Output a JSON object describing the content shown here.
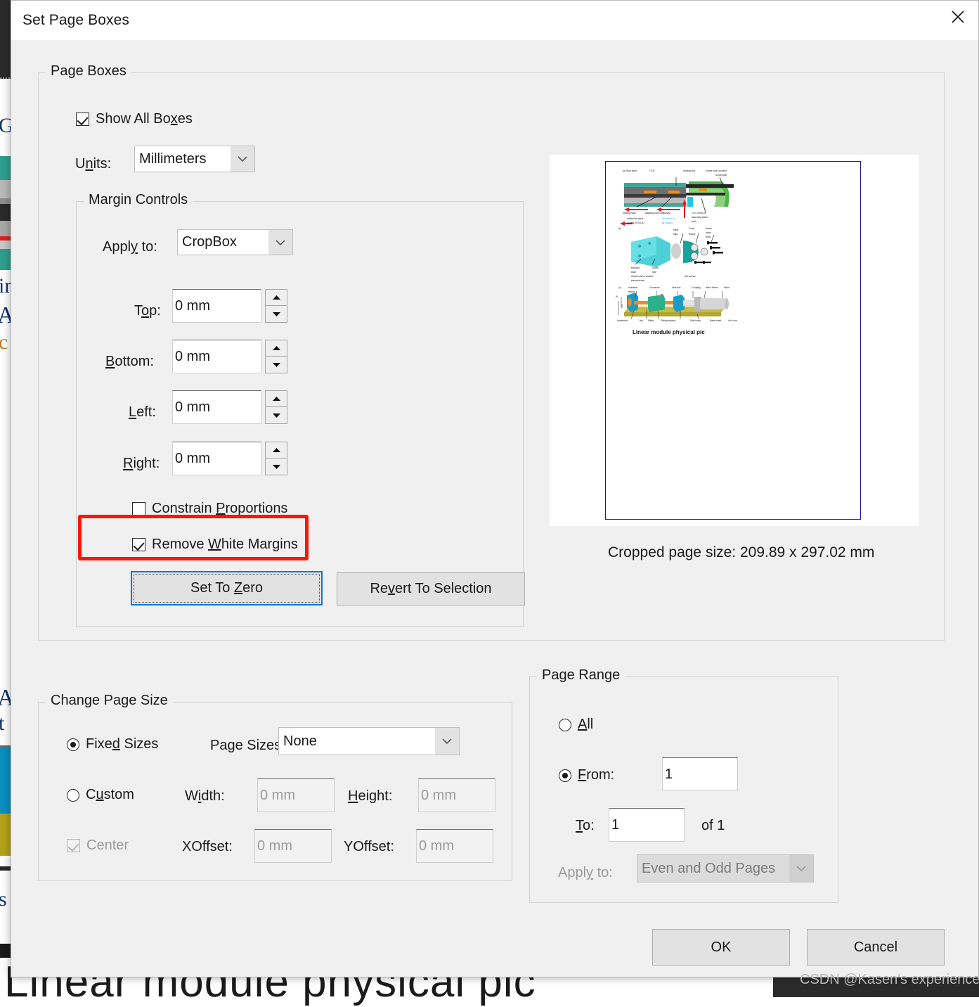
{
  "background": {
    "visible_text_fragments": [
      "Ge",
      "in",
      "A",
      "c",
      "A",
      "t",
      "s"
    ],
    "bottom_text": "Linear module physical pic"
  },
  "dialog": {
    "title": "Set Page Boxes",
    "close_icon": "close-icon"
  },
  "page_boxes": {
    "legend": "Page Boxes",
    "show_all_boxes": {
      "label": "Show All Boxes",
      "checked": true,
      "accel": "x"
    },
    "units": {
      "label": "Units:",
      "accel": "n",
      "value": "Millimeters"
    }
  },
  "margin_controls": {
    "legend": "Margin Controls",
    "apply_to": {
      "label": "Apply to:",
      "accel": "y",
      "value": "CropBox"
    },
    "fields": [
      {
        "label": "Top:",
        "accel": "o",
        "value": "0 mm"
      },
      {
        "label": "Bottom:",
        "accel": "B",
        "value": "0 mm"
      },
      {
        "label": "Left:",
        "accel": "L",
        "value": "0 mm"
      },
      {
        "label": "Right:",
        "accel": "R",
        "value": "0 mm"
      }
    ],
    "constrain_proportions": {
      "label": "Constrain Proportions",
      "checked": false,
      "accel": "P"
    },
    "remove_white_margins": {
      "label": "Remove White Margins",
      "checked": true,
      "accel": "W",
      "highlighted": true
    },
    "set_to_zero": {
      "label": "Set To Zero",
      "accel": "Z",
      "focused": true
    },
    "revert_to_selection": {
      "label": "Revert To Selection",
      "accel": "v"
    }
  },
  "preview": {
    "caption": "Cropped page size: 209.89 x 297.02 mm",
    "thumbnail_caption": "Linear module physical pic",
    "thumbnail_labels": {
      "a": [
        "(a) Gear shaft",
        "TG B",
        "Sealing ring",
        "Center tube (connect",
        "to ball joint)",
        "Sealing rings",
        "Adapting pipe (stationary)",
        "TG C (fixed on",
        "assembly datum",
        "part)",
        "Airflow for active",
        "cooling of OVLBJ",
        "Air tube B (to",
        "air supply)"
      ],
      "b": [
        "(b)",
        "Steel",
        "balls",
        "Cover",
        "Screw",
        "holes",
        "Bolts",
        "Rotary",
        "Ball joint",
        "base",
        "Screw",
        "hole",
        "Outlet hole for shafted",
        "electrical wire",
        "Set screws"
      ],
      "c": [
        "(c)",
        "Actuation",
        "tendon",
        "Connector",
        "Vent bolt",
        "Coupling",
        "Motor fixture",
        "Motor",
        "Leadscrew",
        "Nut",
        "Slider",
        "Sliding bearing",
        "Side board",
        "Base board",
        "Unit: mm",
        "75",
        "132"
      ]
    }
  },
  "change_page_size": {
    "legend": "Change Page Size",
    "fixed_sizes": {
      "label": "Fixed Sizes",
      "accel": "d",
      "selected": true
    },
    "custom": {
      "label": "Custom",
      "accel": "u",
      "selected": false
    },
    "center": {
      "label": "Center",
      "checked": true,
      "disabled": true
    },
    "page_sizes": {
      "label": "Page Sizes:",
      "accel": "g",
      "value": "None"
    },
    "width": {
      "label": "Width:",
      "accel": "i",
      "placeholder": "0 mm"
    },
    "height": {
      "label": "Height:",
      "accel": "H",
      "placeholder": "0 mm"
    },
    "xoffset": {
      "label": "XOffset:",
      "placeholder": "0 mm"
    },
    "yoffset": {
      "label": "YOffset:",
      "placeholder": "0 mm"
    }
  },
  "page_range": {
    "legend": "Page Range",
    "all": {
      "label": "All",
      "accel": "A",
      "selected": false
    },
    "from": {
      "label": "From:",
      "accel": "F",
      "selected": true,
      "value": "1"
    },
    "to": {
      "label": "To:",
      "accel": "T",
      "value": "1"
    },
    "of_total": "of 1",
    "apply_to": {
      "label": "Apply to:",
      "accel": "y",
      "value": "Even and Odd Pages",
      "disabled": true
    }
  },
  "footer": {
    "ok": "OK",
    "cancel": "Cancel"
  },
  "watermark": "CSDN @Kasen's experience",
  "colors": {
    "dialog_bg": "#f0f0f0",
    "accent_focus": "#0078d7",
    "annotation_red": "#fb1605",
    "thumb_border": "#1a1a8c"
  }
}
